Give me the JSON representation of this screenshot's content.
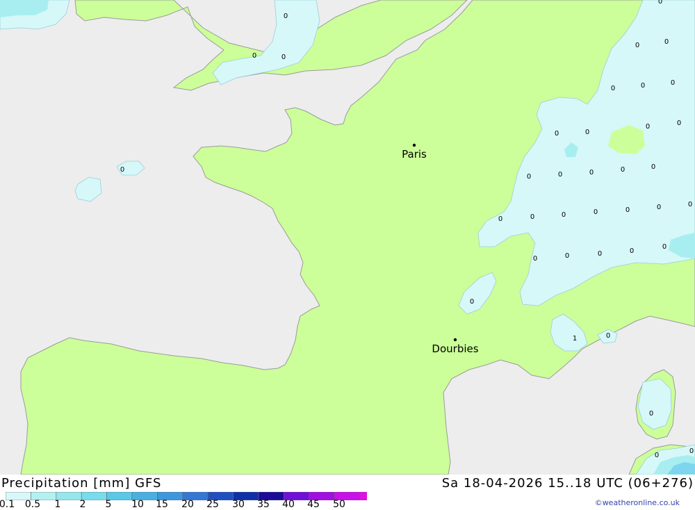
{
  "header": {
    "title": "Precipitation [mm] GFS",
    "datetime": "Sa 18-04-2026 15..18 UTC (06+276)"
  },
  "cities": [
    {
      "name": "Paris"
    },
    {
      "name": "Dourbies"
    }
  ],
  "values": [
    "0",
    "0",
    "0",
    "0",
    "0",
    "0",
    "0",
    "0",
    "0",
    "0",
    "0",
    "0",
    "0",
    "0",
    "0",
    "0",
    "0",
    "0",
    "0",
    "0",
    "0",
    "0",
    "0",
    "0",
    "0",
    "0",
    "0",
    "0",
    "0",
    "0",
    "0",
    "0",
    "0",
    "1",
    "0",
    "0",
    "0"
  ],
  "legend": {
    "labels": [
      "0.1",
      "0.5",
      "1",
      "2",
      "5",
      "10",
      "15",
      "20",
      "25",
      "30",
      "35",
      "40",
      "45",
      "50"
    ],
    "colors": [
      "#d6f8f8",
      "#b4f0f0",
      "#96e6ec",
      "#78dcec",
      "#5ac8e6",
      "#4ab0e0",
      "#3e96dc",
      "#3478d2",
      "#2050c0",
      "#1030a8",
      "#1c0c98",
      "#7010d8",
      "#a010e0",
      "#c810e8",
      "#e010e0",
      "#c010b0"
    ]
  },
  "credit": "©weatheronline.co.uk"
}
